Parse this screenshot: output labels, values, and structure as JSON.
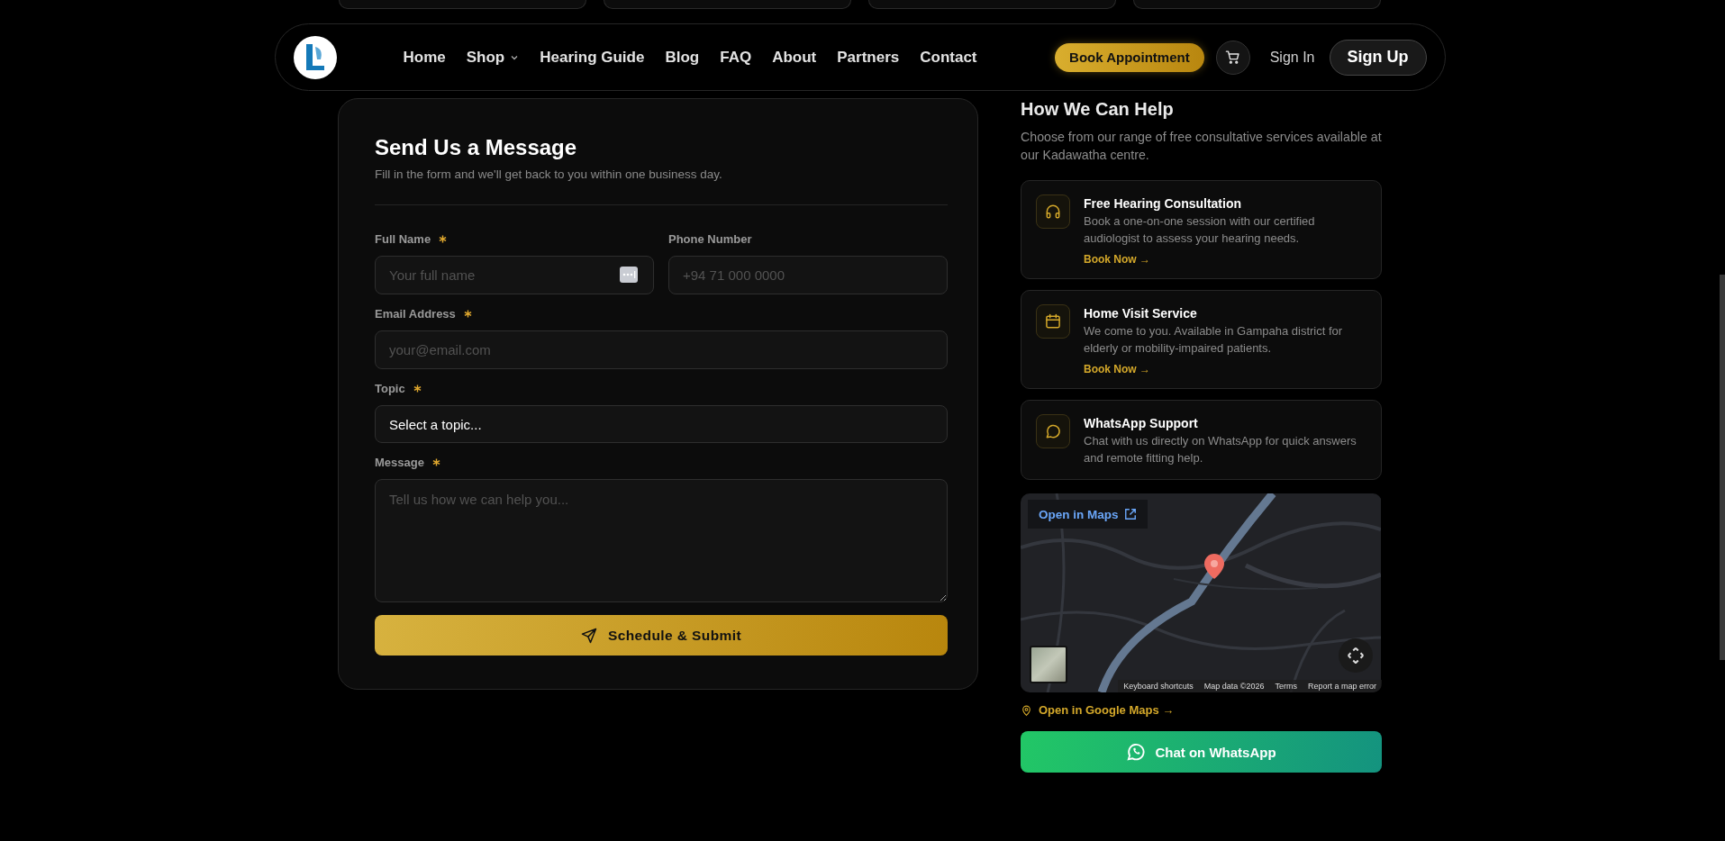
{
  "nav": {
    "links": [
      {
        "label": "Home",
        "kind": "link"
      },
      {
        "label": "Shop",
        "kind": "dropdown"
      },
      {
        "label": "Hearing Guide",
        "kind": "link"
      },
      {
        "label": "Blog",
        "kind": "link"
      },
      {
        "label": "FAQ",
        "kind": "link"
      },
      {
        "label": "About",
        "kind": "link"
      },
      {
        "label": "Partners",
        "kind": "link"
      },
      {
        "label": "Contact",
        "kind": "link"
      }
    ],
    "cta": "Book Appointment",
    "sign_in": "Sign In",
    "sign_up": "Sign Up"
  },
  "form": {
    "title": "Send Us a Message",
    "subtitle": "Fill in the form and we'll get back to you within one business day.",
    "rows": [
      [
        {
          "label": "Full Name",
          "required": true,
          "kind": "text",
          "placeholder": "Your full name",
          "autofill_badge": true
        },
        {
          "label": "Phone Number",
          "required": false,
          "kind": "text",
          "placeholder": "+94 71 000 0000"
        }
      ],
      [
        {
          "label": "Email Address",
          "required": true,
          "kind": "text",
          "placeholder": "your@email.com"
        }
      ],
      [
        {
          "label": "Topic",
          "required": true,
          "kind": "select",
          "value": "Select a topic..."
        }
      ],
      [
        {
          "label": "Message",
          "required": true,
          "kind": "textarea",
          "placeholder": "Tell us how we can help you..."
        }
      ]
    ],
    "submit": "Schedule & Submit"
  },
  "help": {
    "title": "How We Can Help",
    "description": "Choose from our range of free consultative services available at our Kadawatha centre.",
    "services": [
      {
        "kind": "headphones",
        "title": "Free Hearing Consultation",
        "description": "Book a one-on-one session with our certified audiologist to assess your hearing needs.",
        "link": "Book Now →"
      },
      {
        "kind": "calendar",
        "title": "Home Visit Service",
        "description": "We come to you. Available in Gampaha district for elderly or mobility-impaired patients.",
        "link": "Book Now →"
      },
      {
        "kind": "chat",
        "title": "WhatsApp Support",
        "description": "Chat with us directly on WhatsApp for quick answers and remote fitting help."
      }
    ]
  },
  "map": {
    "kind": "picture",
    "open_button": "Open in Maps",
    "attribution": [
      "Keyboard shortcuts",
      "Map data ©2026",
      "Terms",
      "Report a map error"
    ]
  },
  "map_link": "Open in Google Maps →",
  "whatsapp_button": "Chat on WhatsApp"
}
